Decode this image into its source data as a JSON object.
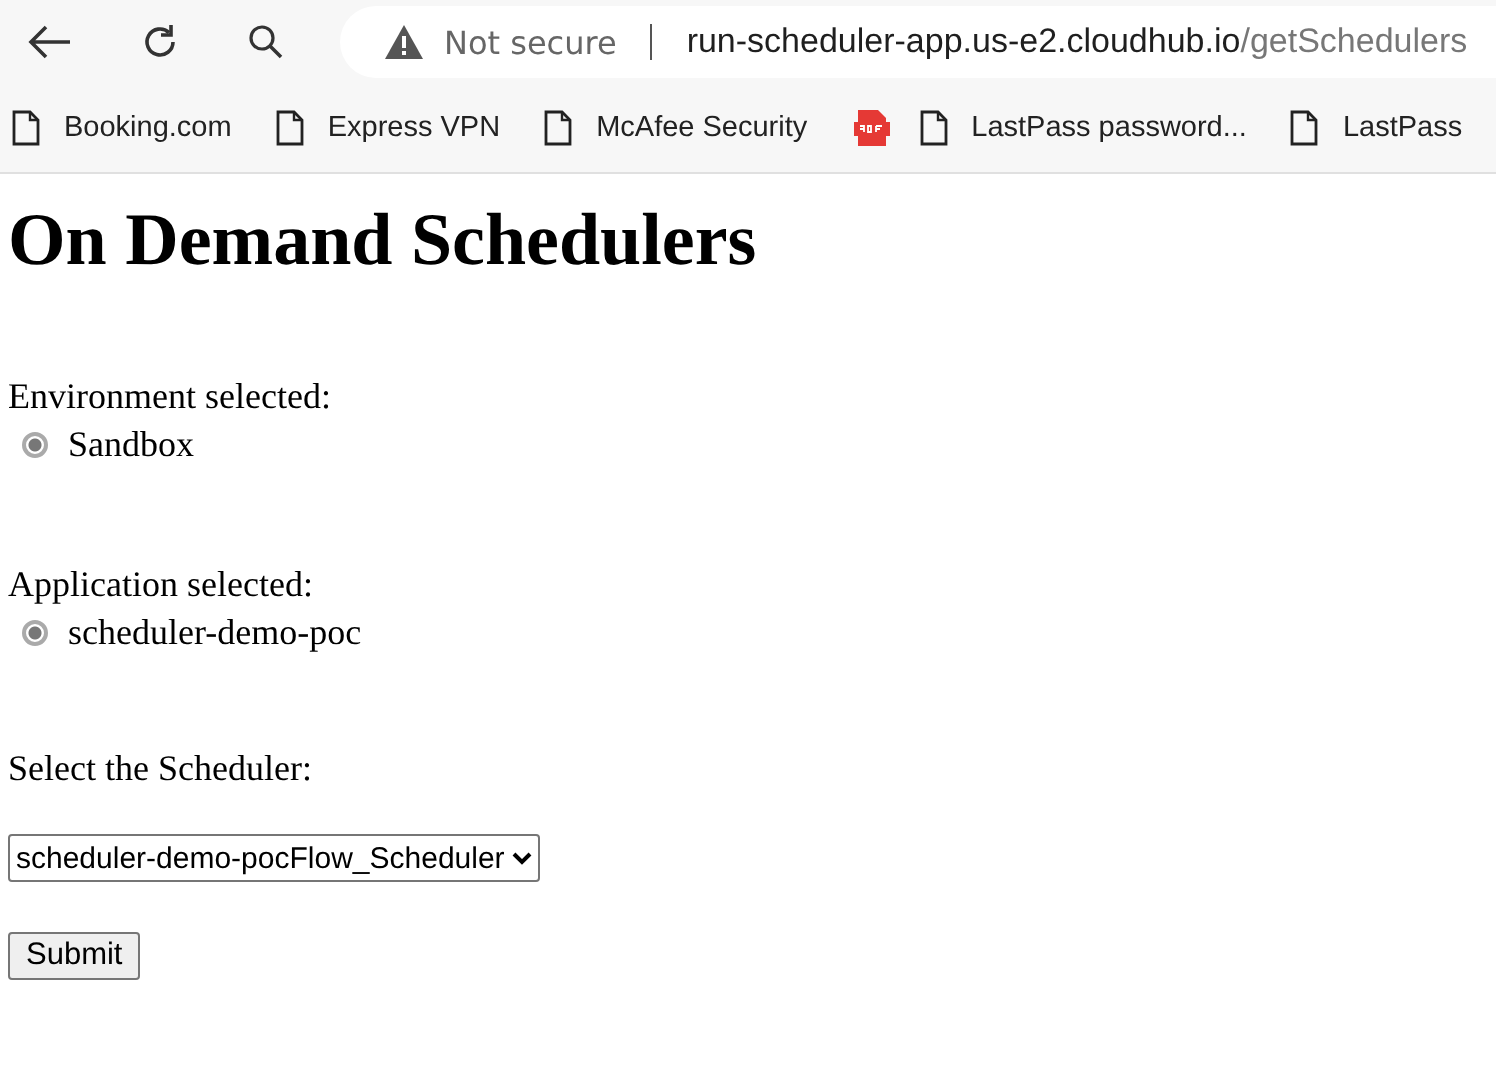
{
  "browser": {
    "security_label": "Not secure",
    "url_host": "run-scheduler-app.us-e2.cloudhub.io",
    "url_path": "/getSchedulers"
  },
  "bookmarks": [
    {
      "label": "Booking.com",
      "kind": "page"
    },
    {
      "label": "Express VPN",
      "kind": "page"
    },
    {
      "label": "McAfee Security",
      "kind": "page"
    },
    {
      "kind": "pdf"
    },
    {
      "label": "LastPass password...",
      "kind": "page"
    },
    {
      "label": "LastPass",
      "kind": "page"
    }
  ],
  "page": {
    "title": "On Demand Schedulers",
    "sections": [
      {
        "label": "Environment selected:",
        "option": {
          "label": "Sandbox",
          "checked": true
        }
      },
      {
        "label": "Application selected:",
        "option": {
          "label": "scheduler-demo-poc",
          "checked": true
        }
      }
    ],
    "select_label": "Select the Scheduler:",
    "select_value": "scheduler-demo-pocFlow_Scheduler",
    "submit": "Submit"
  }
}
